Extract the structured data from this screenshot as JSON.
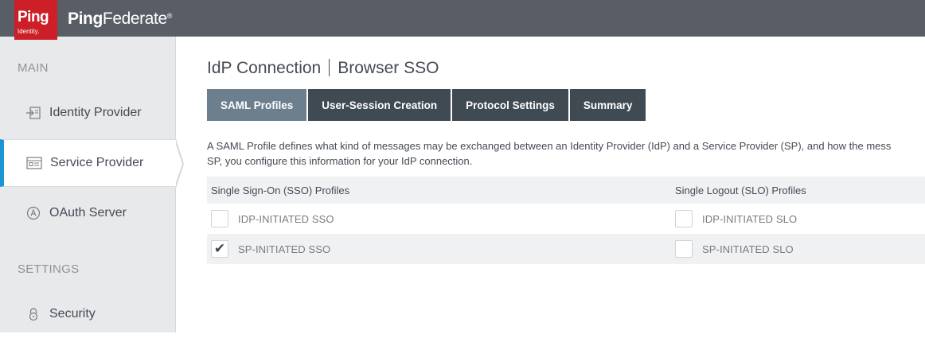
{
  "header": {
    "logo_ping": "Ping",
    "logo_identity": "Identity.",
    "app_name_bold": "Ping",
    "app_name_rest": "Federate",
    "trademark": "®"
  },
  "sidebar": {
    "section_main": "MAIN",
    "section_settings": "SETTINGS",
    "items": [
      {
        "label": "Identity Provider",
        "icon": "identity-provider-icon",
        "active": false
      },
      {
        "label": "Service Provider",
        "icon": "service-provider-icon",
        "active": true
      },
      {
        "label": "OAuth Server",
        "icon": "oauth-icon",
        "active": false
      },
      {
        "label": "Security",
        "icon": "lock-icon",
        "active": false
      }
    ]
  },
  "main": {
    "title_left": "IdP Connection",
    "title_right": "Browser SSO",
    "tabs": [
      {
        "label": "SAML Profiles",
        "active": true
      },
      {
        "label": "User-Session Creation",
        "active": false
      },
      {
        "label": "Protocol Settings",
        "active": false
      },
      {
        "label": "Summary",
        "active": false
      }
    ],
    "description_line1": "A SAML Profile defines what kind of messages may be exchanged between an Identity Provider (IdP) and a Service Provider (SP), and how the mess",
    "description_line2": "SP, you configure this information for your IdP connection.",
    "sso_header": "Single Sign-On (SSO) Profiles",
    "slo_header": "Single Logout (SLO) Profiles",
    "sso_profiles": [
      {
        "label": "IDP-INITIATED SSO",
        "checked": false
      },
      {
        "label": "SP-INITIATED SSO",
        "checked": true
      }
    ],
    "slo_profiles": [
      {
        "label": "IDP-INITIATED SLO",
        "checked": false
      },
      {
        "label": "SP-INITIATED SLO",
        "checked": false
      }
    ],
    "check_mark": "✔"
  },
  "colors": {
    "topbar": "#585d66",
    "brand_red": "#cc1f28",
    "active_tab": "#6b7f8f",
    "tab": "#3f4a53",
    "active_accent": "#1c95d4"
  }
}
